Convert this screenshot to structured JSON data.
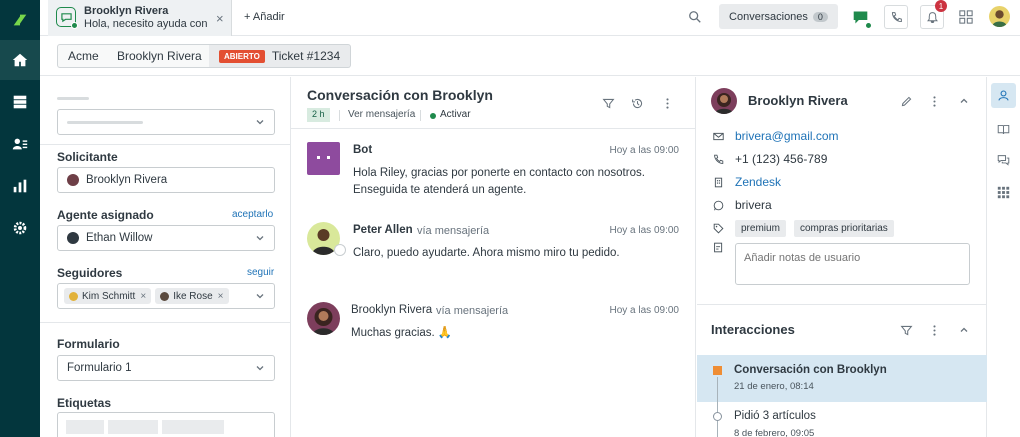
{
  "topbar": {
    "tab_name": "Brooklyn Rivera",
    "tab_preview": "Hola, necesito ayuda con",
    "add_label": "Añadir",
    "conversations_label": "Conversaciones",
    "conversations_count": "0",
    "notification_count": "1"
  },
  "breadcrumb": {
    "org": "Acme",
    "requester": "Brooklyn Rivera",
    "status": "ABIERTO",
    "ticket": "Ticket #1234"
  },
  "left": {
    "requester_label": "Solicitante",
    "requester_value": "Brooklyn Rivera",
    "assignee_label": "Agente asignado",
    "assignee_link": "aceptarlo",
    "assignee_value": "Ethan Willow",
    "followers_label": "Seguidores",
    "followers_link": "seguir",
    "followers": [
      "Kim Schmitt",
      "Ike Rose"
    ],
    "form_label": "Formulario",
    "form_value": "Formulario 1",
    "tags_label": "Etiquetas"
  },
  "conversation": {
    "title": "Conversación con Brooklyn",
    "time_badge": "2 h",
    "channel": "Ver mensajería",
    "status": "Activar",
    "messages": [
      {
        "sender": "Bot",
        "via": "",
        "time": "Hoy a las 09:00",
        "text": "Hola Riley, gracias por ponerte en contacto con nosotros. Enseguida te atenderá un agente."
      },
      {
        "sender": "Peter Allen",
        "via": "vía mensajería",
        "time": "Hoy a las 09:00",
        "text": "Claro, puedo ayudarte. Ahora mismo miro tu pedido."
      },
      {
        "sender": "Brooklyn Rivera",
        "via": "vía mensajería",
        "time": "Hoy a las 09:00",
        "text": "Muchas gracias. 🙏"
      }
    ]
  },
  "profile": {
    "name": "Brooklyn Rivera",
    "email": "brivera@gmail.com",
    "phone": "+1 (123) 456-789",
    "org": "Zendesk",
    "whatsapp": "brivera",
    "tags": [
      "premium",
      "compras prioritarias"
    ],
    "notes_placeholder": "Añadir notas de usuario"
  },
  "interactions": {
    "title": "Interacciones",
    "items": [
      {
        "title": "Conversación con Brooklyn",
        "date": "21 de enero, 08:14"
      },
      {
        "title": "Pidió 3 artículos",
        "date": "8 de febrero, 09:05"
      }
    ]
  },
  "colors": {
    "rail": "#03363d",
    "accent_green": "#1f8a4c",
    "link": "#1f73b7",
    "open_badge": "#e34f32",
    "selected_row": "#d6e7f2"
  }
}
